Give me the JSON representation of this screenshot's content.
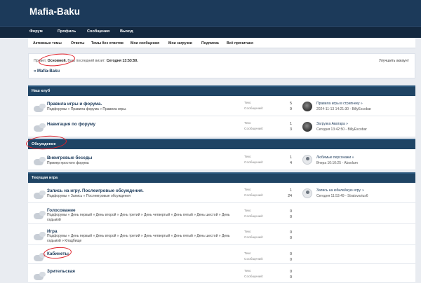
{
  "site": {
    "title": "Mafia-Baku"
  },
  "nav": [
    "Форум",
    "Профиль",
    "Сообщения",
    "Выход"
  ],
  "subnav": [
    "Активные темы",
    "Ответы",
    "Темы без ответов",
    "Мои сообщения",
    "Мои загрузки",
    "Подписка",
    "Всё прочитано"
  ],
  "welcome": {
    "prefix": "Привет,",
    "user": "Основной.",
    "last_visit_label": "Ваш последний визит:",
    "last_visit": "Сегодня 13:53:50."
  },
  "improve_account": "Улучшить аккаунт",
  "breadcrumb": "» Mafia-Baku",
  "labels": {
    "topics": "Тем:",
    "posts": "Сообщений:"
  },
  "categories": [
    {
      "title": "Наш клуб",
      "forums": [
        {
          "title": "Правила игры и форума.",
          "sub": "Подфорумы » Правила форума » Правила игры.",
          "topics": "5",
          "posts": "9",
          "last_title": "Правила игры в стрипнеку »",
          "last_meta": "2024-11-13 14:21:30 - BillyEscobar",
          "avatar": "dark"
        },
        {
          "title": "Навигация по форуму",
          "sub": "",
          "topics": "1",
          "posts": "3",
          "last_title": "Загрузка Аватара »",
          "last_meta": "Сегодня 13:42:50 - BillyEscobar",
          "avatar": "dark"
        }
      ]
    },
    {
      "title": "Обсуждение",
      "forums": [
        {
          "title": "Внеигровые беседы",
          "sub": "Пример простого форума",
          "topics": "1",
          "posts": "4",
          "last_title": "Любимые персонажи »",
          "last_meta": "Вчера 10:10:25 - Absolam",
          "avatar": "light"
        }
      ]
    },
    {
      "title": "Текущая игра",
      "forums": [
        {
          "title": "Запись на игру. Послеигровые обсуждения.",
          "sub": "Подфорумы » Запись » Послеигровые обсуждения",
          "topics": "1",
          "posts": "24",
          "last_title": "Запись на юбилейную игру. »",
          "last_meta": "Сегодня 11:53:49 - Stratovarius6",
          "avatar": "light"
        },
        {
          "title": "Голосование",
          "sub": "Подфорумы » День первый » День второй » День третий » День четвертый » День пятый » День шестой » День седьмой",
          "topics": "0",
          "posts": "0",
          "last_title": "",
          "last_meta": "",
          "avatar": ""
        },
        {
          "title": "Игра",
          "sub": "Подфорумы » День первый » День второй » День третий » День четвертый » День пятый » День шестой » День седьмой » Кладбище",
          "topics": "0",
          "posts": "0",
          "last_title": "",
          "last_meta": "",
          "avatar": ""
        },
        {
          "title": "Кабинеты",
          "sub": "",
          "topics": "0",
          "posts": "0",
          "last_title": "",
          "last_meta": "",
          "avatar": ""
        },
        {
          "title": "Зрительская",
          "sub": "",
          "topics": "0",
          "posts": "0",
          "last_title": "",
          "last_meta": "",
          "avatar": ""
        }
      ]
    }
  ]
}
